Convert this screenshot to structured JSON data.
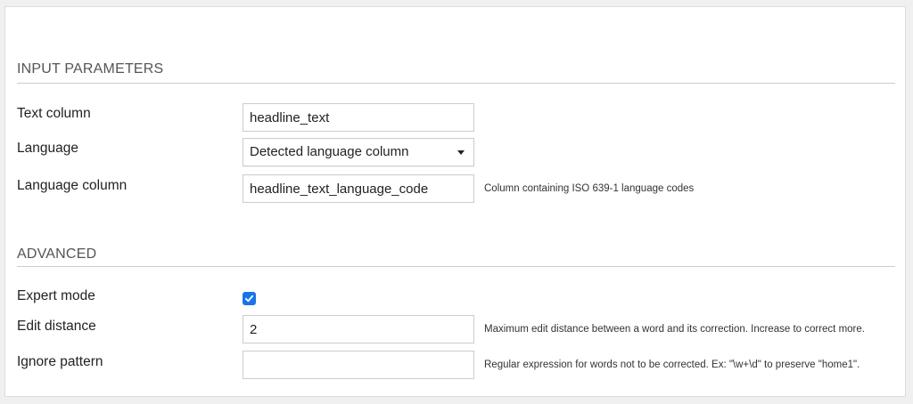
{
  "input_parameters": {
    "title": "INPUT PARAMETERS",
    "text_column": {
      "label": "Text column",
      "value": "headline_text"
    },
    "language": {
      "label": "Language",
      "selected": "Detected language column"
    },
    "language_column": {
      "label": "Language column",
      "value": "headline_text_language_code",
      "help": "Column containing ISO 639-1 language codes"
    }
  },
  "advanced": {
    "title": "ADVANCED",
    "expert_mode": {
      "label": "Expert mode",
      "checked": true
    },
    "edit_distance": {
      "label": "Edit distance",
      "value": "2",
      "help": "Maximum edit distance between a word and its correction. Increase to correct more."
    },
    "ignore_pattern": {
      "label": "Ignore pattern",
      "value": "",
      "help": "Regular expression for words not to be corrected. Ex: \"\\w+\\d\" to preserve \"home1\"."
    }
  },
  "colors": {
    "checkbox_accent": "#1a73e8",
    "divider": "#cccccc",
    "section_title": "#555555"
  }
}
